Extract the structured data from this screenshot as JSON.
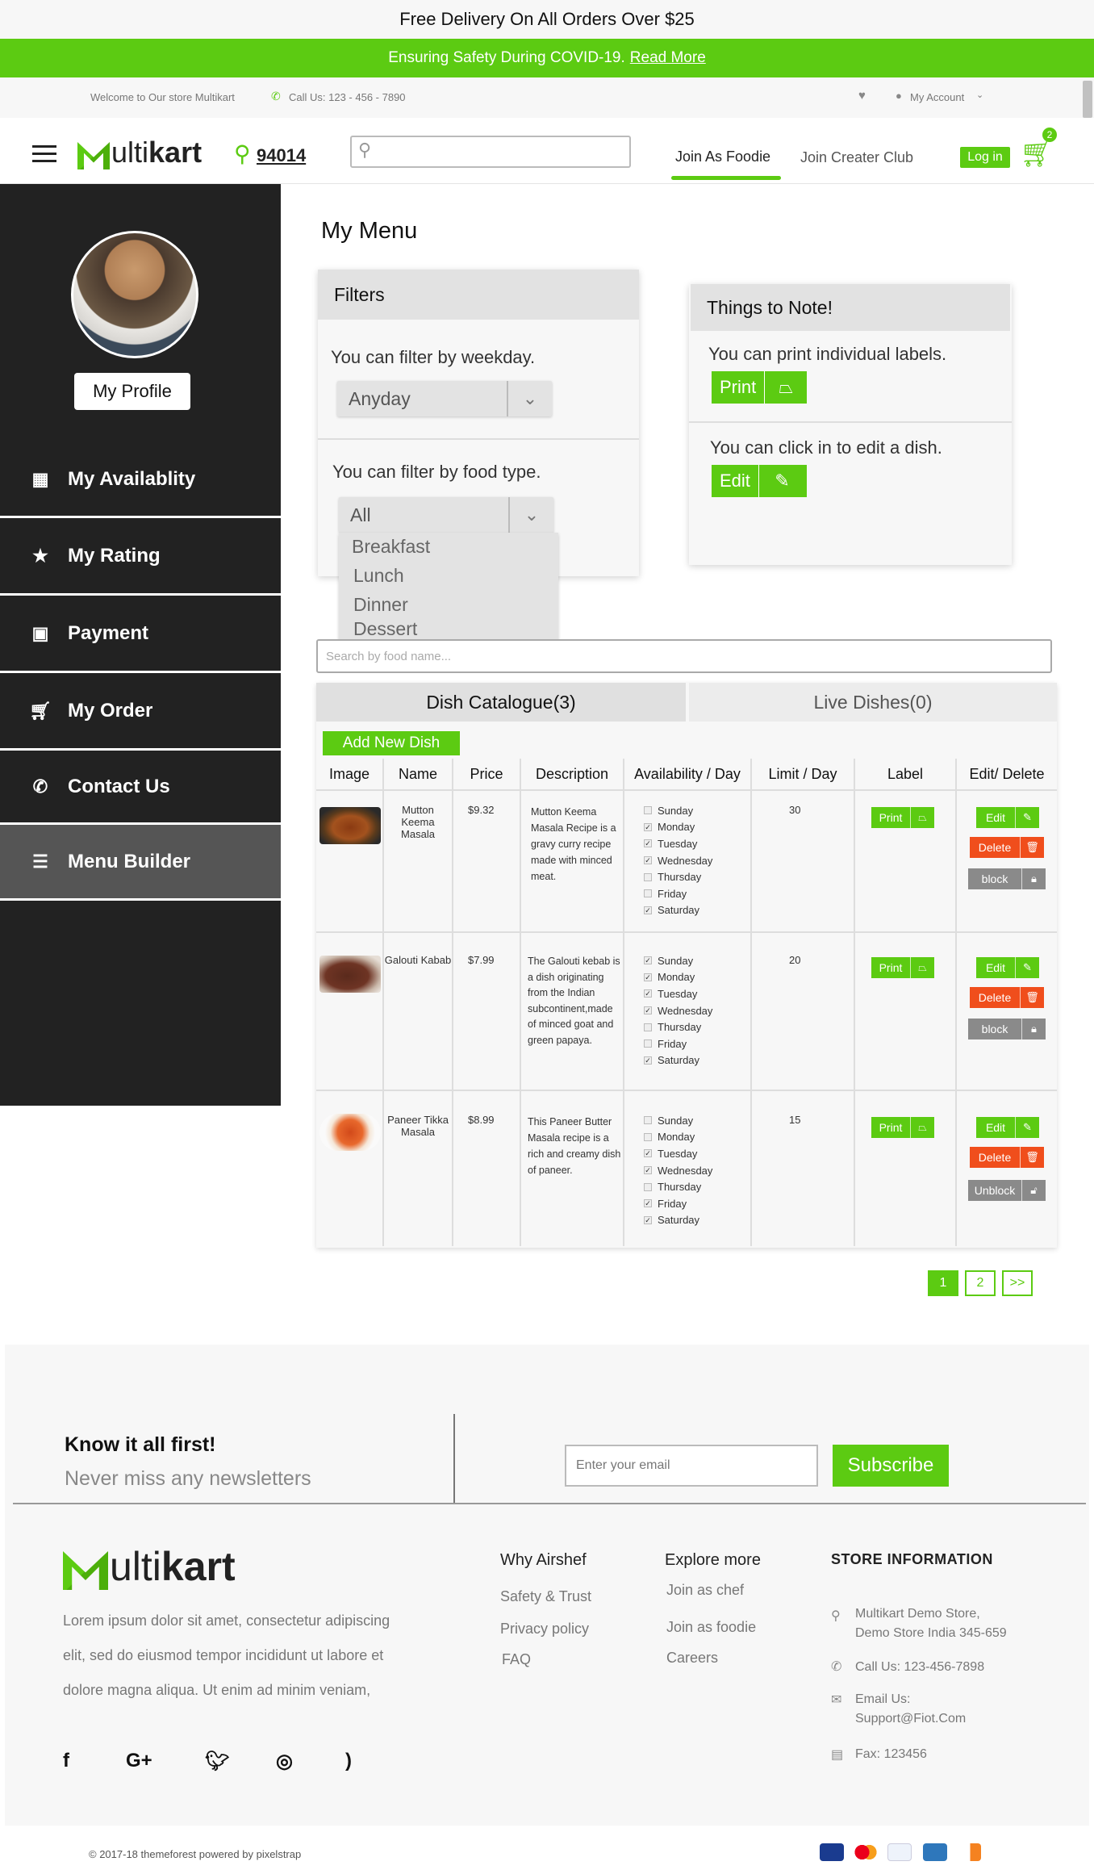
{
  "promo": {
    "text": "Free Delivery On All Orders Over $25"
  },
  "covid": {
    "text": "Ensuring Safety During COVID-19.",
    "link": "Read More"
  },
  "topbar": {
    "welcome": "Welcome to Our store Multikart",
    "call": "Call Us: 123 - 456 - 7890",
    "account": "My Account"
  },
  "header": {
    "logo_first": "M",
    "logo_rest1": "ulti",
    "logo_rest2": "kart",
    "zip": "94014",
    "search_placeholder": "",
    "nav_foodie": "Join As Foodie",
    "nav_creator": "Join Creater Club",
    "login": "Log in",
    "cart_count": "2"
  },
  "sidebar": {
    "profile_button": "My Profile",
    "items": [
      {
        "label": "My Availablity",
        "icon": "calendar-icon"
      },
      {
        "label": "My Rating",
        "icon": "star-icon"
      },
      {
        "label": "Payment",
        "icon": "money-icon"
      },
      {
        "label": "My Order",
        "icon": "cart-icon"
      },
      {
        "label": "Contact Us",
        "icon": "phone-icon"
      },
      {
        "label": "Menu Builder",
        "icon": "list-icon"
      }
    ],
    "active": "Menu Builder"
  },
  "main": {
    "title": "My Menu",
    "filters": {
      "heading": "Filters",
      "weekday_label": "You can filter by weekday.",
      "weekday_value": "Anyday",
      "foodtype_label": "You can filter by food type.",
      "foodtype_value": "All",
      "foodtype_options": [
        "Breakfast",
        "Lunch",
        "Dinner",
        "Dessert"
      ]
    },
    "notes": {
      "heading": "Things to Note!",
      "print_text": "You can print individual labels.",
      "print_button": "Print",
      "edit_text": "You can click in to edit a dish.",
      "edit_button": "Edit"
    },
    "search_placeholder": "Search by food name...",
    "tabs": [
      {
        "label": "Dish Catalogue(3)"
      },
      {
        "label": "Live Dishes(0)"
      }
    ],
    "add_button": "Add New Dish",
    "columns": [
      "Image",
      "Name",
      "Price",
      "Description",
      "Availability / Day",
      "Limit / Day",
      "Label",
      "Edit/ Delete"
    ],
    "days": [
      "Sunday",
      "Monday",
      "Tuesday",
      "Wednesday",
      "Thursday",
      "Friday",
      "Saturday"
    ],
    "rows": [
      {
        "name": "Mutton Keema Masala",
        "price": "$9.32",
        "description": "Mutton Keema Masala Recipe is a gravy curry recipe made with minced meat.",
        "checked": [
          false,
          true,
          true,
          true,
          false,
          false,
          true
        ],
        "limit": "30",
        "label_button": "Print",
        "edit": "Edit",
        "delete": "Delete",
        "block": "block"
      },
      {
        "name": "Galouti Kabab",
        "price": "$7.99",
        "description": "The Galouti kebab is a dish originating from the Indian subcontinent,made of minced goat and green papaya.",
        "checked": [
          true,
          true,
          true,
          true,
          false,
          false,
          true
        ],
        "limit": "20",
        "label_button": "Print",
        "edit": "Edit",
        "delete": "Delete",
        "block": "block"
      },
      {
        "name": "Paneer Tikka Masala",
        "price": "$8.99",
        "description": "This Paneer Butter Masala recipe is a rich and creamy dish of paneer.",
        "checked": [
          false,
          false,
          true,
          true,
          false,
          true,
          true
        ],
        "limit": "15",
        "label_button": "Print",
        "edit": "Edit",
        "delete": "Delete",
        "block": "Unblock"
      }
    ],
    "pagination": [
      "1",
      "2",
      ">>"
    ]
  },
  "footer": {
    "newsletter_title": "Know it all first!",
    "newsletter_sub": "Never miss any newsletters",
    "email_placeholder": "Enter your email",
    "subscribe": "Subscribe",
    "about": [
      "Lorem ipsum dolor sit amet, consectetur adipiscing",
      "elit, sed do eiusmod tempor incididunt ut labore et",
      "dolore magna aliqua. Ut enim ad minim veniam,"
    ],
    "why_title": "Why Airshef",
    "why_links": [
      "Safety & Trust",
      "Privacy policy",
      "FAQ"
    ],
    "explore_title": "Explore more",
    "explore_links": [
      "Join as chef",
      "Join as foodie",
      "Careers"
    ],
    "store_title": "STORE INFORMATION",
    "store_address": [
      "Multikart Demo Store,",
      "Demo Store India 345-659"
    ],
    "store_call": "Call Us: 123-456-7898",
    "store_email": [
      "Email Us:",
      "Support@Fiot.Com"
    ],
    "store_fax": "Fax: 123456",
    "social": [
      "facebook-icon",
      "google-plus-icon",
      "twitter-icon",
      "instagram-icon",
      "rss-icon"
    ],
    "copyright": "© 2017-18 themeforest powered by pixelstrap",
    "payments": [
      "visa-icon",
      "mastercard-icon",
      "paypal-icon",
      "amex-icon",
      "discover-icon"
    ]
  },
  "colors": {
    "accent": "#5ccb12",
    "sidebar": "#222222",
    "active_item": "#555555",
    "delete": "#f04e1c",
    "block": "#8a8a8a"
  }
}
